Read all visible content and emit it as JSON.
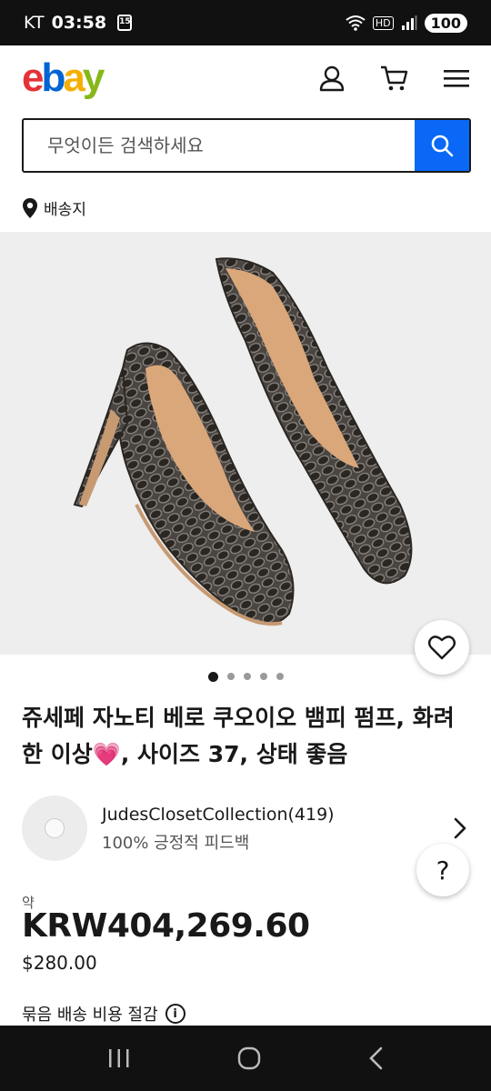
{
  "status_bar": {
    "carrier": "KT",
    "time": "03:58",
    "calendar_day": "15",
    "network": "HD",
    "battery": "100"
  },
  "header": {
    "logo_letters": [
      {
        "ch": "e",
        "color": "#e53238"
      },
      {
        "ch": "b",
        "color": "#0064d2"
      },
      {
        "ch": "a",
        "color": "#f5af02"
      },
      {
        "ch": "y",
        "color": "#86b817"
      }
    ]
  },
  "search": {
    "placeholder": "무엇이든 검색하세요"
  },
  "ship_to": {
    "label": "배송지"
  },
  "gallery": {
    "image_count": 5,
    "active_index": 0
  },
  "listing": {
    "title": "쥬세페 자노티 베로 쿠오이오 뱀피 펌프, 화려한 이상💗, 사이즈 37, 상태 좋음",
    "seller": {
      "name": "JudesClosetCollection(419)",
      "feedback": "100% 긍정적 피드백"
    },
    "price_prefix": "약",
    "price_krw": "KRW404,269.60",
    "price_usd": "$280.00",
    "bundle_label": "묶음 배송 비용 절감",
    "help_label": "?"
  },
  "colors": {
    "accent": "#0968f6",
    "text": "#191919"
  }
}
